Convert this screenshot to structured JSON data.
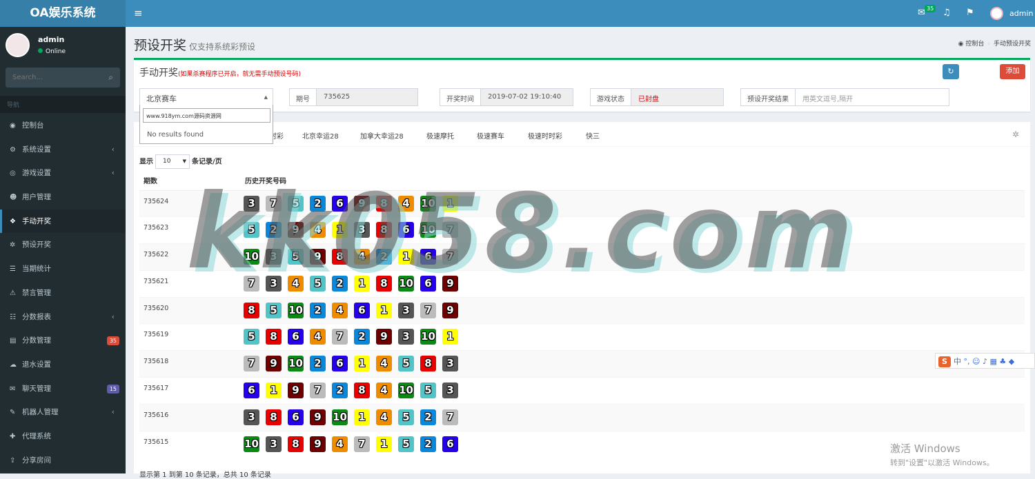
{
  "app": {
    "logo": "OA娱乐系统"
  },
  "topbar": {
    "toggle": "≡",
    "mail_count": "35",
    "user": "admin"
  },
  "sidebar": {
    "user": {
      "name": "admin",
      "status": "Online"
    },
    "search_placeholder": "Search...",
    "nav_header": "导航",
    "items": [
      {
        "label": "控制台",
        "icon": "dashboard-icon",
        "glyph": "◉"
      },
      {
        "label": "系统设置",
        "icon": "cogs-icon",
        "glyph": "⚙",
        "caret": "‹"
      },
      {
        "label": "游戏设置",
        "icon": "gamepad-icon",
        "glyph": "◎",
        "caret": "‹"
      },
      {
        "label": "用户管理",
        "icon": "users-icon",
        "glyph": "☻"
      },
      {
        "label": "手动开奖",
        "icon": "cubes-icon",
        "glyph": "❖",
        "active": true
      },
      {
        "label": "预设开奖",
        "icon": "gear-icon",
        "glyph": "✲"
      },
      {
        "label": "当期统计",
        "icon": "list-icon",
        "glyph": "☰"
      },
      {
        "label": "禁言管理",
        "icon": "warning-icon",
        "glyph": "⚠"
      },
      {
        "label": "分数报表",
        "icon": "list-ul-icon",
        "glyph": "☷",
        "caret": "‹"
      },
      {
        "label": "分数管理",
        "icon": "database-icon",
        "glyph": "▤",
        "badge": "35",
        "badge_color": "#dd4b39"
      },
      {
        "label": "退水设置",
        "icon": "cloud-icon",
        "glyph": "☁"
      },
      {
        "label": "聊天管理",
        "icon": "comments-icon",
        "glyph": "✉",
        "badge": "15",
        "badge_color": "#605ca8"
      },
      {
        "label": "机器人管理",
        "icon": "comment-icon",
        "glyph": "✎",
        "caret": "‹"
      },
      {
        "label": "代理系统",
        "icon": "user-plus-icon",
        "glyph": "✚"
      },
      {
        "label": "分享房间",
        "icon": "share-icon",
        "glyph": "⇪"
      }
    ]
  },
  "page": {
    "title": "预设开奖",
    "subtitle": "仅支持系统彩预设",
    "breadcrumb": [
      "控制台",
      "手动预设开奖"
    ]
  },
  "manual": {
    "title": "手动开奖",
    "note": "(如果杀赛程序已开启，就无需手动预设号码)",
    "refresh": "↻",
    "add": "添加",
    "game": "北京赛车",
    "period_label": "期号",
    "period": "735625",
    "time_label": "开奖时间",
    "time": "2019-07-02 19:10:40",
    "state_label": "游戏状态",
    "state": "已封盘",
    "preset_label": "预设开奖结果",
    "preset_placeholder": "用英文逗号,隔开",
    "dropdown_search": "www.918ym.com源码资源网",
    "dropdown_empty": "No results found"
  },
  "tabs": [
    "时彩",
    "北京幸运28",
    "加拿大幸运28",
    "极速摩托",
    "极速赛车",
    "极速时时彩",
    "快三"
  ],
  "table": {
    "show": "显示",
    "per": "条记录/页",
    "page_size": "10",
    "col_period": "期数",
    "col_history": "历史开奖号码",
    "rows": [
      {
        "p": "735624",
        "n": [
          3,
          7,
          5,
          2,
          6,
          9,
          8,
          4,
          10,
          1
        ]
      },
      {
        "p": "735623",
        "n": [
          5,
          2,
          9,
          4,
          1,
          3,
          8,
          6,
          10,
          7
        ]
      },
      {
        "p": "735622",
        "n": [
          10,
          3,
          5,
          9,
          8,
          4,
          2,
          1,
          6,
          7
        ]
      },
      {
        "p": "735621",
        "n": [
          7,
          3,
          4,
          5,
          2,
          1,
          8,
          10,
          6,
          9
        ]
      },
      {
        "p": "735620",
        "n": [
          8,
          5,
          10,
          2,
          4,
          6,
          1,
          3,
          7,
          9
        ]
      },
      {
        "p": "735619",
        "n": [
          5,
          8,
          6,
          4,
          7,
          2,
          9,
          3,
          10,
          1
        ]
      },
      {
        "p": "735618",
        "n": [
          7,
          9,
          10,
          2,
          6,
          1,
          4,
          5,
          8,
          3
        ]
      },
      {
        "p": "735617",
        "n": [
          6,
          1,
          9,
          7,
          2,
          8,
          4,
          10,
          5,
          3
        ]
      },
      {
        "p": "735616",
        "n": [
          3,
          8,
          6,
          9,
          10,
          1,
          4,
          5,
          2,
          7
        ]
      },
      {
        "p": "735615",
        "n": [
          10,
          3,
          8,
          9,
          4,
          7,
          1,
          5,
          2,
          6
        ]
      }
    ],
    "footer": "显示第 1 到第 10 条记录，总共 10 条记录"
  },
  "ball_colors": {
    "1": "#ffff00",
    "2": "#0b87d9",
    "3": "#555555",
    "4": "#ee8c00",
    "5": "#52c3c6",
    "6": "#2500e8",
    "7": "#bbbbbb",
    "8": "#e60000",
    "9": "#6d0000",
    "10": "#0a8a14"
  },
  "watermark": "kk058.com",
  "ime": {
    "s": "S",
    "text": "中 °, ☺ ♪ ▦ ♣ ◆"
  },
  "windows": {
    "line1": "激活 Windows",
    "line2": "转到\"设置\"以激活 Windows。"
  }
}
